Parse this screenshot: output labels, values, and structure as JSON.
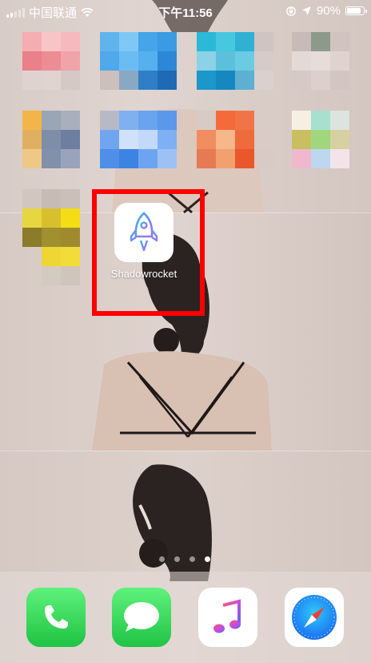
{
  "status_bar": {
    "carrier": "中国联通",
    "time": "下午11:56",
    "battery_percent": "90%",
    "battery_level": 0.9,
    "signal_bars": 2
  },
  "apps": {
    "highlighted": {
      "label": "Shadowrocket",
      "icon": "rocket-icon"
    }
  },
  "page_indicator": {
    "total": 4,
    "active": 4
  },
  "dock": {
    "apps": [
      {
        "name": "phone-icon"
      },
      {
        "name": "messages-icon"
      },
      {
        "name": "music-icon"
      },
      {
        "name": "safari-icon"
      }
    ]
  },
  "colors": {
    "highlight": "#ff0000",
    "phone_green": "#2fd158",
    "messages_green": "#34c759"
  }
}
